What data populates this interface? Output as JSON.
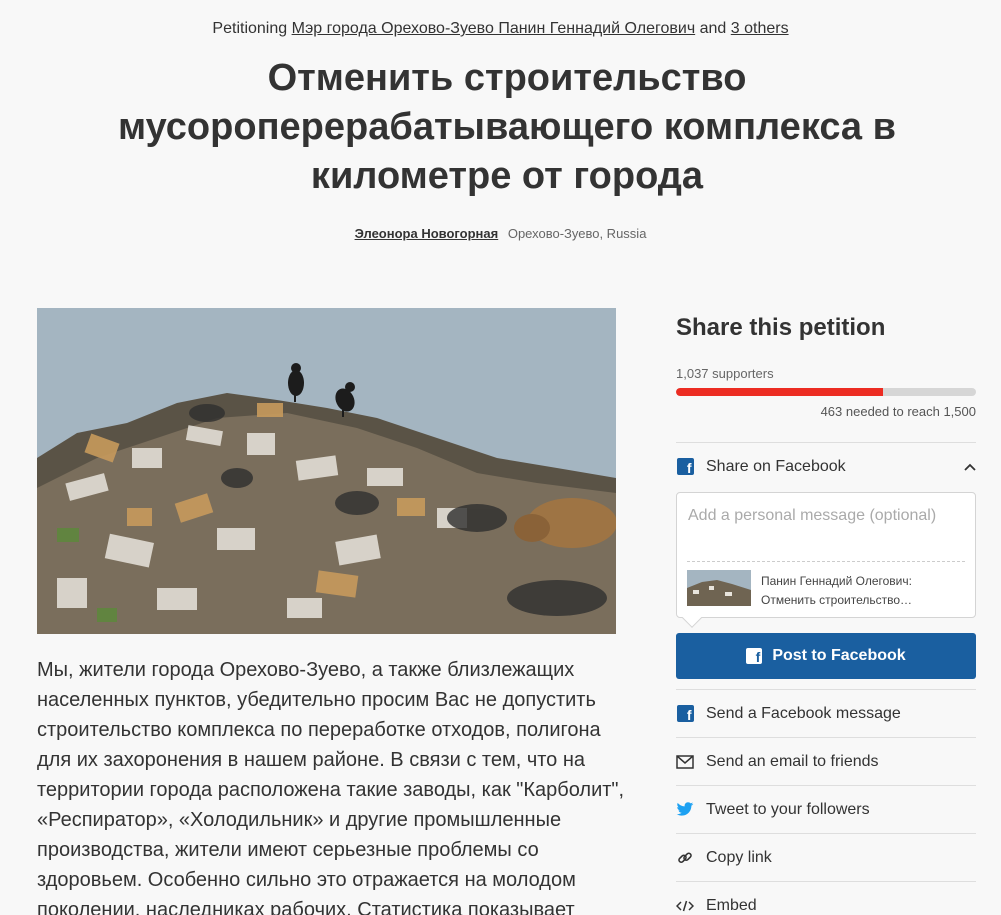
{
  "header": {
    "petitioning_prefix": "Petitioning",
    "target": "Мэр города Орехово-Зуево Панин Геннадий Олегович",
    "and_word": "and",
    "others": "3 others"
  },
  "petition": {
    "title": "Отменить строительство мусороперерабатывающего комплекса в километре от города",
    "author": "Элеонора Новогорная",
    "location": "Орехово-Зуево, Russia",
    "body": "Мы, жители города Орехово-Зуево, а также близлежащих населенных пунктов, убедительно просим Вас не допустить строительство комплекса по переработке отходов, полигона для их захоронения в нашем районе. В связи с тем, что на территории города расположена такие заводы, как \"Карболит\", «Респиратор», «Холодильник» и другие промышленные производства, жители имеют серьезные проблемы со здоровьем. Особенно сильно это отражается на молодом поколении, наследниках рабочих. Статистика показывает"
  },
  "sidebar": {
    "title": "Share this petition",
    "supporters": "1,037 supporters",
    "progress": 0.691,
    "needed": "463 needed to reach 1,500",
    "share_facebook": "Share on Facebook",
    "message_placeholder": "Add a personal message (optional)",
    "preview_line1": "Панин Геннадий Олегович:",
    "preview_line2": "Отменить строительство…",
    "post_button": "Post to Facebook",
    "send_fb_message": "Send a Facebook message",
    "send_email": "Send an email to friends",
    "tweet": "Tweet to your followers",
    "copy_link": "Copy link",
    "embed": "Embed"
  },
  "colors": {
    "accent_red": "#ec2c22",
    "facebook_blue": "#1a5fa0",
    "twitter_blue": "#1da1f2"
  }
}
